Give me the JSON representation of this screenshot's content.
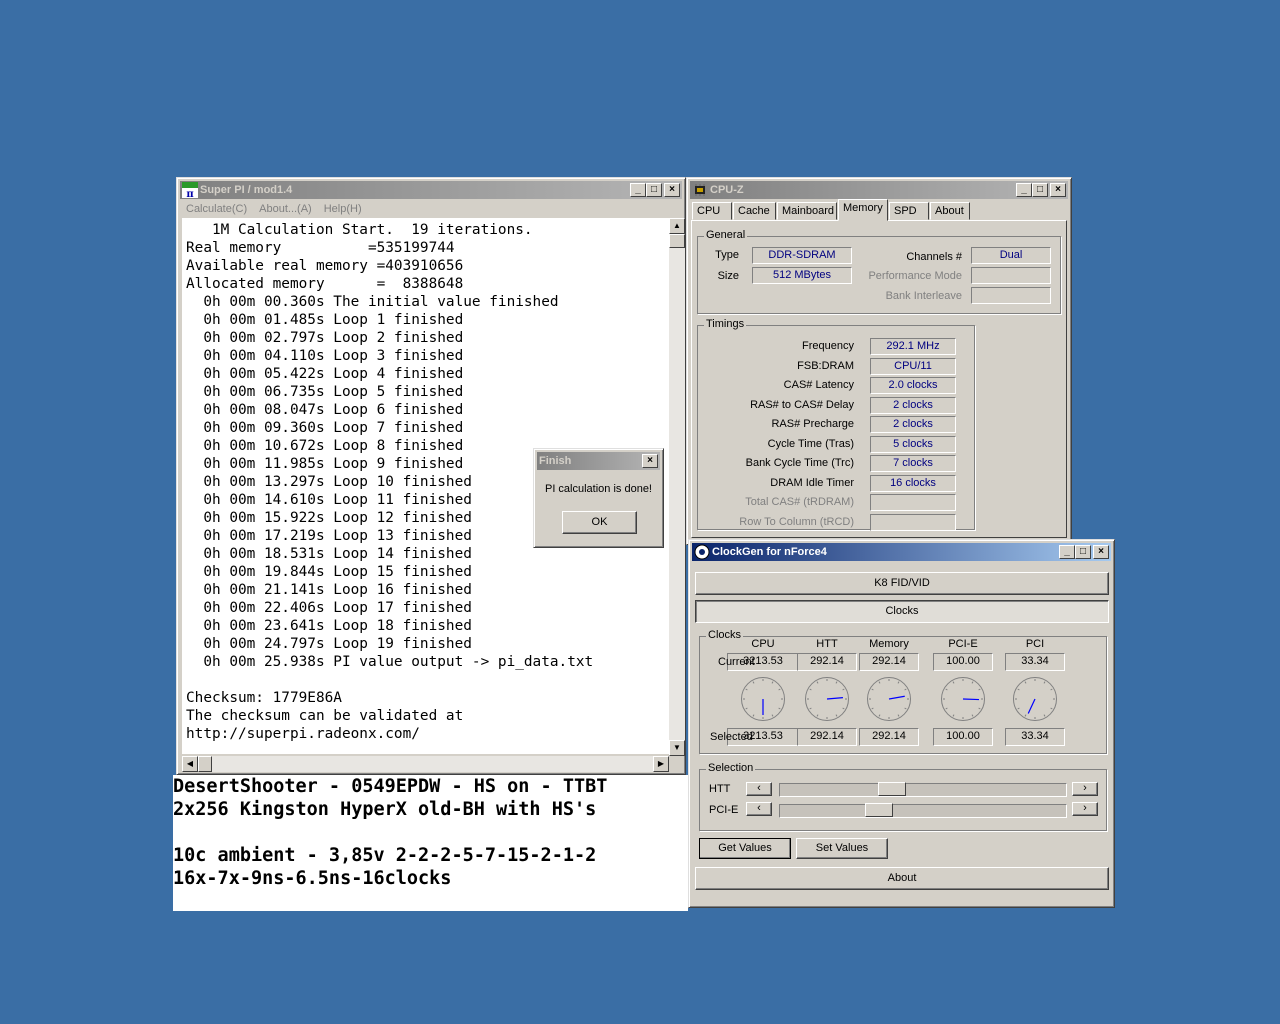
{
  "superpi": {
    "title": "Super PI / mod1.4",
    "menu": [
      "Calculate(C)",
      "About...(A)",
      "Help(H)"
    ],
    "console_lines": [
      "   1M Calculation Start.  19 iterations.",
      "Real memory          =535199744",
      "Available real memory =403910656",
      "Allocated memory      =  8388648",
      "  0h 00m 00.360s The initial value finished",
      "  0h 00m 01.485s Loop 1 finished",
      "  0h 00m 02.797s Loop 2 finished",
      "  0h 00m 04.110s Loop 3 finished",
      "  0h 00m 05.422s Loop 4 finished",
      "  0h 00m 06.735s Loop 5 finished",
      "  0h 00m 08.047s Loop 6 finished",
      "  0h 00m 09.360s Loop 7 finished",
      "  0h 00m 10.672s Loop 8 finished",
      "  0h 00m 11.985s Loop 9 finished",
      "  0h 00m 13.297s Loop 10 finished",
      "  0h 00m 14.610s Loop 11 finished",
      "  0h 00m 15.922s Loop 12 finished",
      "  0h 00m 17.219s Loop 13 finished",
      "  0h 00m 18.531s Loop 14 finished",
      "  0h 00m 19.844s Loop 15 finished",
      "  0h 00m 21.141s Loop 16 finished",
      "  0h 00m 22.406s Loop 17 finished",
      "  0h 00m 23.641s Loop 18 finished",
      "  0h 00m 24.797s Loop 19 finished",
      "  0h 00m 25.938s PI value output -> pi_data.txt",
      "",
      "Checksum: 1779E86A",
      "The checksum can be validated at",
      "http://superpi.radeonx.com/"
    ]
  },
  "finish_dialog": {
    "title": "Finish",
    "message": "PI calculation is done!",
    "ok_label": "OK"
  },
  "notes": {
    "lines": [
      "DesertShooter - 0549EPDW - HS on - TTBT",
      "2x256 Kingston HyperX old-BH with HS's",
      "",
      "10c ambient - 3,85v 2-2-2-5-7-15-2-1-2",
      "16x-7x-9ns-6.5ns-16clocks"
    ]
  },
  "cpuz": {
    "title": "CPU-Z",
    "tabs": [
      "CPU",
      "Cache",
      "Mainboard",
      "Memory",
      "SPD",
      "About"
    ],
    "selected_tab": "Memory",
    "general": {
      "group_title": "General",
      "type_label": "Type",
      "type_value": "DDR-SDRAM",
      "size_label": "Size",
      "size_value": "512 MBytes",
      "channels_label": "Channels #",
      "channels_value": "Dual",
      "perf_mode_label": "Performance Mode",
      "bank_interleave_label": "Bank Interleave"
    },
    "timings": {
      "group_title": "Timings",
      "rows": [
        {
          "label": "Frequency",
          "value": "292.1 MHz",
          "enabled": true
        },
        {
          "label": "FSB:DRAM",
          "value": "CPU/11",
          "enabled": true
        },
        {
          "label": "CAS# Latency",
          "value": "2.0 clocks",
          "enabled": true
        },
        {
          "label": "RAS# to CAS# Delay",
          "value": "2 clocks",
          "enabled": true
        },
        {
          "label": "RAS# Precharge",
          "value": "2 clocks",
          "enabled": true
        },
        {
          "label": "Cycle Time (Tras)",
          "value": "5 clocks",
          "enabled": true
        },
        {
          "label": "Bank Cycle Time (Trc)",
          "value": "7 clocks",
          "enabled": true
        },
        {
          "label": "DRAM Idle Timer",
          "value": "16 clocks",
          "enabled": true
        },
        {
          "label": "Total CAS# (tRDRAM)",
          "value": "",
          "enabled": false
        },
        {
          "label": "Row To Column (tRCD)",
          "value": "",
          "enabled": false
        }
      ]
    }
  },
  "clockgen": {
    "title": "ClockGen for nForce4",
    "k8_button": "K8 FID/VID",
    "clocks_button": "Clocks",
    "clocks_group": "Clocks",
    "columns": [
      "CPU",
      "HTT",
      "Memory",
      "PCI-E",
      "PCI"
    ],
    "current_label": "Current",
    "current": [
      "3213.53",
      "292.14",
      "292.14",
      "100.00",
      "33.34"
    ],
    "selected_label": "Selected",
    "selected": [
      "3213.53",
      "292.14",
      "292.14",
      "100.00",
      "33.34"
    ],
    "selection_group": "Selection",
    "htt_label": "HTT",
    "pcie_label": "PCI-E",
    "htt_slider_fraction": 0.38,
    "pcie_slider_fraction": 0.33,
    "get_values": "Get Values",
    "set_values": "Set Values",
    "about": "About"
  },
  "colors": {
    "desktop": "#3a6ea5",
    "active_title": "#0a246a",
    "inactive_title": "#808080",
    "value_text": "#000080"
  }
}
